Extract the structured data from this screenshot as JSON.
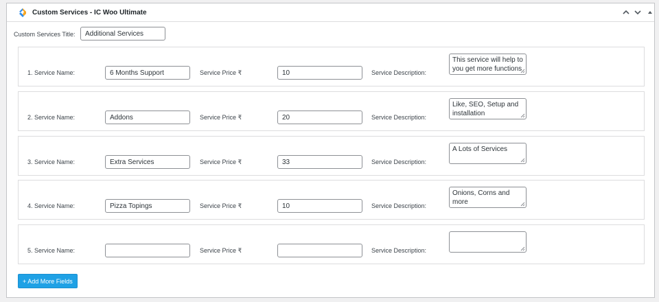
{
  "box": {
    "title": "Custom Services - IC Woo Ultimate",
    "icon": "plugin-logo-icon",
    "header_buttons": [
      "move-up-icon",
      "move-down-icon",
      "toggle-panel-icon"
    ]
  },
  "services_title": {
    "label": "Custom Services Title:",
    "value": "Additional Services"
  },
  "services": [
    {
      "name_label": "1. Service Name:",
      "name": "6 Months Support",
      "price_label": "Service Price ₹",
      "price": "10",
      "desc_label": "Service Description:",
      "description": "This service will help to you get more functions"
    },
    {
      "name_label": "2. Service Name:",
      "name": "Addons",
      "price_label": "Service Price ₹",
      "price": "20",
      "desc_label": "Service Description:",
      "description": "Like, SEO, Setup and installation"
    },
    {
      "name_label": "3. Service Name:",
      "name": "Extra Services",
      "price_label": "Service Price ₹",
      "price": "33",
      "desc_label": "Service Description:",
      "description": "A Lots of Services"
    },
    {
      "name_label": "4. Service Name:",
      "name": "Pizza Topings",
      "price_label": "Service Price ₹",
      "price": "10",
      "desc_label": "Service Description:",
      "description": "Onions, Corns and more"
    },
    {
      "name_label": "5. Service Name:",
      "name": "",
      "price_label": "Service Price ₹",
      "price": "",
      "desc_label": "Service Description:",
      "description": ""
    }
  ],
  "add_button": {
    "label": "+ Add More Fields"
  },
  "colors": {
    "button": "#1fa1e5",
    "border": "#c3c4c7",
    "text": "#3c434a"
  }
}
